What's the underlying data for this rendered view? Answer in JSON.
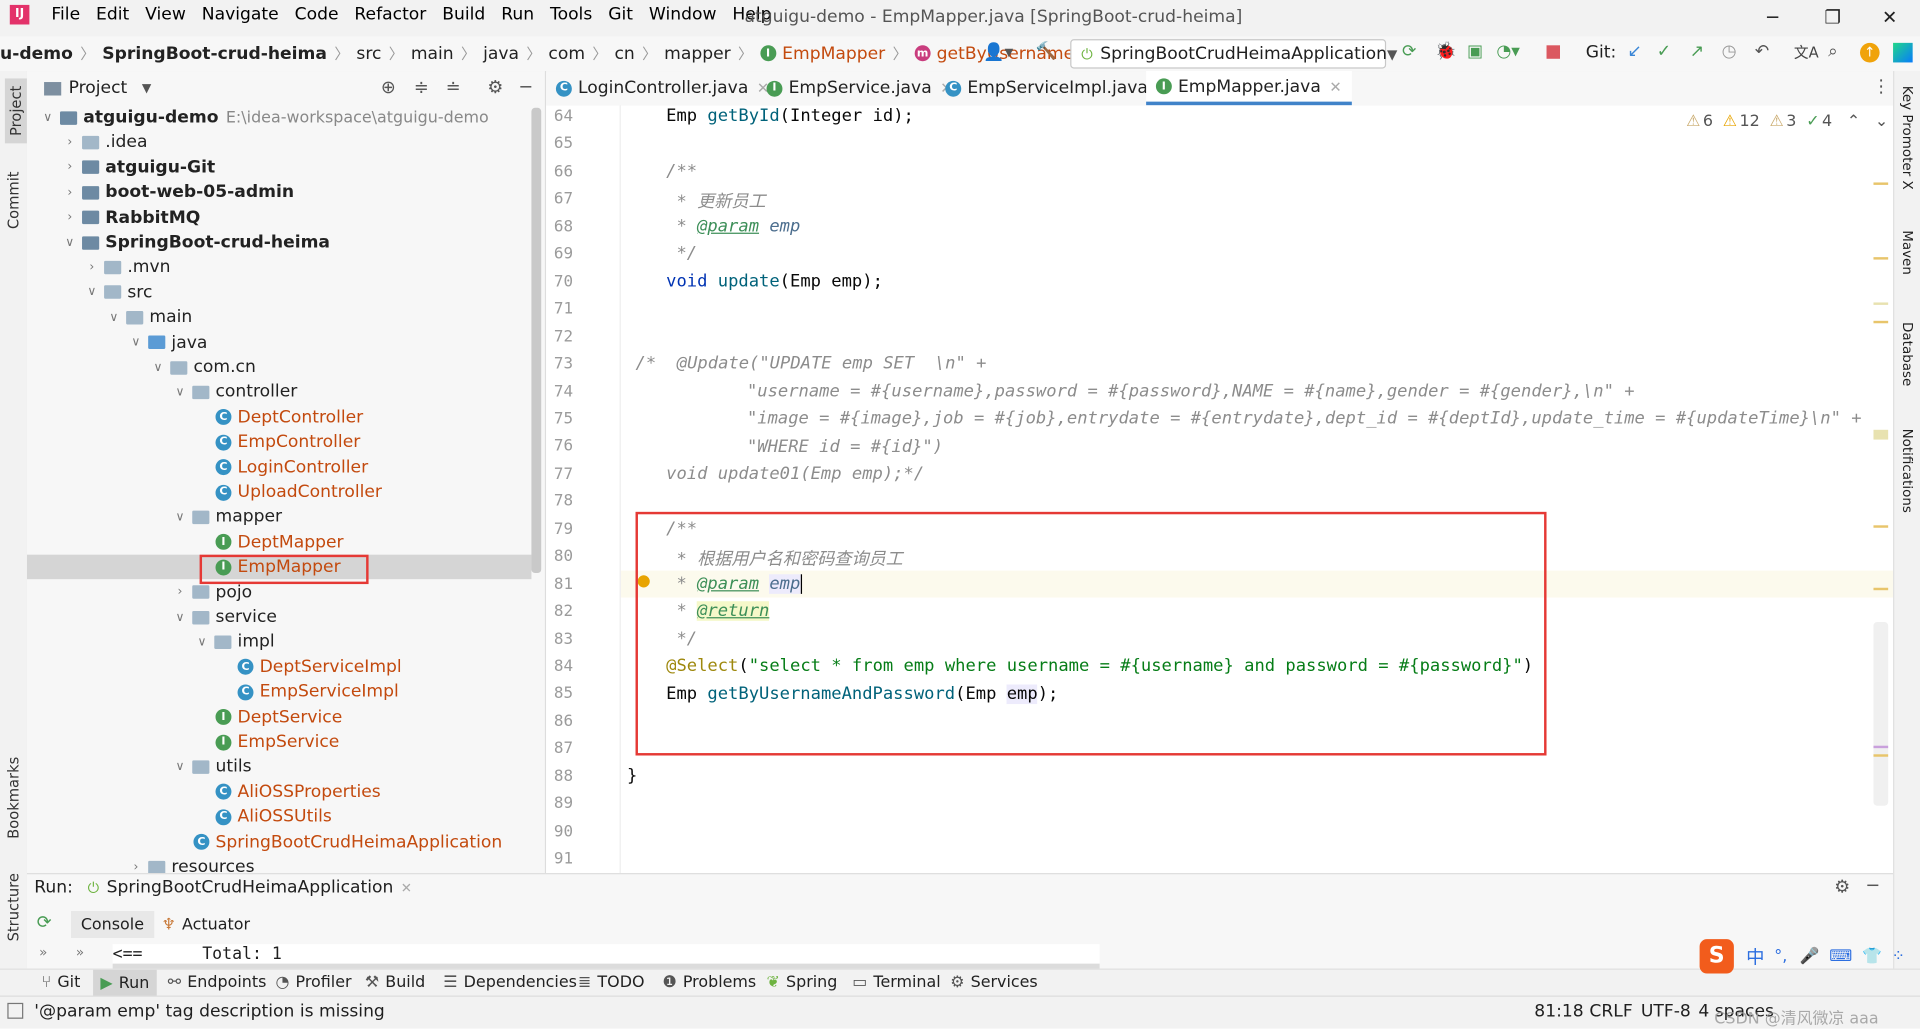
{
  "app": {
    "menu": [
      "File",
      "Edit",
      "View",
      "Navigate",
      "Code",
      "Refactor",
      "Build",
      "Run",
      "Tools",
      "Git",
      "Window",
      "Help"
    ],
    "window_title": "atguigu-demo - EmpMapper.java [SpringBoot-crud-heima]"
  },
  "nav": {
    "crumbs": [
      "u-demo",
      "SpringBoot-crud-heima",
      "src",
      "main",
      "java",
      "com",
      "cn",
      "mapper",
      "EmpMapper",
      "getByUsernameAndPassword"
    ],
    "run_config": "SpringBootCrudHeimaApplication",
    "git_label": "Git:"
  },
  "left_stripe": {
    "project": "Project",
    "commit": "Commit",
    "bookmarks": "Bookmarks",
    "structure": "Structure"
  },
  "right_stripe": {
    "key_promoter": "Key Promoter X",
    "maven": "Maven",
    "database": "Database",
    "notifications": "Notifications"
  },
  "project": {
    "title": "Project",
    "tree": [
      {
        "label": "atguigu-demo",
        "path": "E:\\idea-workspace\\atguigu-demo",
        "bold": true
      },
      {
        "label": ".idea"
      },
      {
        "label": "atguigu-Git",
        "bold": true
      },
      {
        "label": "boot-web-05-admin",
        "bold": true
      },
      {
        "label": "RabbitMQ",
        "bold": true
      },
      {
        "label": "SpringBoot-crud-heima",
        "bold": true
      },
      {
        "label": ".mvn"
      },
      {
        "label": "src"
      },
      {
        "label": "main"
      },
      {
        "label": "java"
      },
      {
        "label": "com.cn"
      },
      {
        "label": "controller"
      },
      {
        "label": "DeptController"
      },
      {
        "label": "EmpController"
      },
      {
        "label": "LoginController"
      },
      {
        "label": "UploadController"
      },
      {
        "label": "mapper"
      },
      {
        "label": "DeptMapper"
      },
      {
        "label": "EmpMapper"
      },
      {
        "label": "pojo"
      },
      {
        "label": "service"
      },
      {
        "label": "impl"
      },
      {
        "label": "DeptServiceImpl"
      },
      {
        "label": "EmpServiceImpl"
      },
      {
        "label": "DeptService"
      },
      {
        "label": "EmpService"
      },
      {
        "label": "utils"
      },
      {
        "label": "AliOSSProperties"
      },
      {
        "label": "AliOSSUtils"
      },
      {
        "label": "SpringBootCrudHeimaApplication"
      },
      {
        "label": "resources"
      }
    ]
  },
  "tabs": [
    "LoginController.java",
    "EmpService.java",
    "EmpServiceImpl.java",
    "EmpMapper.java"
  ],
  "editor": {
    "line_numbers": [
      "64",
      "65",
      "66",
      "67",
      "68",
      "69",
      "70",
      "71",
      "72",
      "73",
      "74",
      "75",
      "76",
      "77",
      "78",
      "79",
      "80",
      "81",
      "82",
      "83",
      "84",
      "85",
      "86",
      "87",
      "88",
      "89",
      "90",
      "91"
    ],
    "warnings": {
      "weak": "6",
      "warn": "12",
      "typo": "3",
      "ok": "4"
    }
  },
  "run": {
    "label": "Run:",
    "config": "SpringBootCrudHeimaApplication",
    "tabs": [
      "Console",
      "Actuator"
    ],
    "output": "<==      Total: 1"
  },
  "bottom_tools": [
    "Git",
    "Run",
    "Endpoints",
    "Profiler",
    "Build",
    "Dependencies",
    "TODO",
    "Problems",
    "Spring",
    "Terminal",
    "Services"
  ],
  "status": {
    "message": "'@param emp' tag description is missing",
    "position": "81:18",
    "line_sep": "CRLF",
    "encoding": "UTF-8",
    "indent": "4 spaces",
    "watermark": "CSDN @清风微凉 aaa"
  }
}
